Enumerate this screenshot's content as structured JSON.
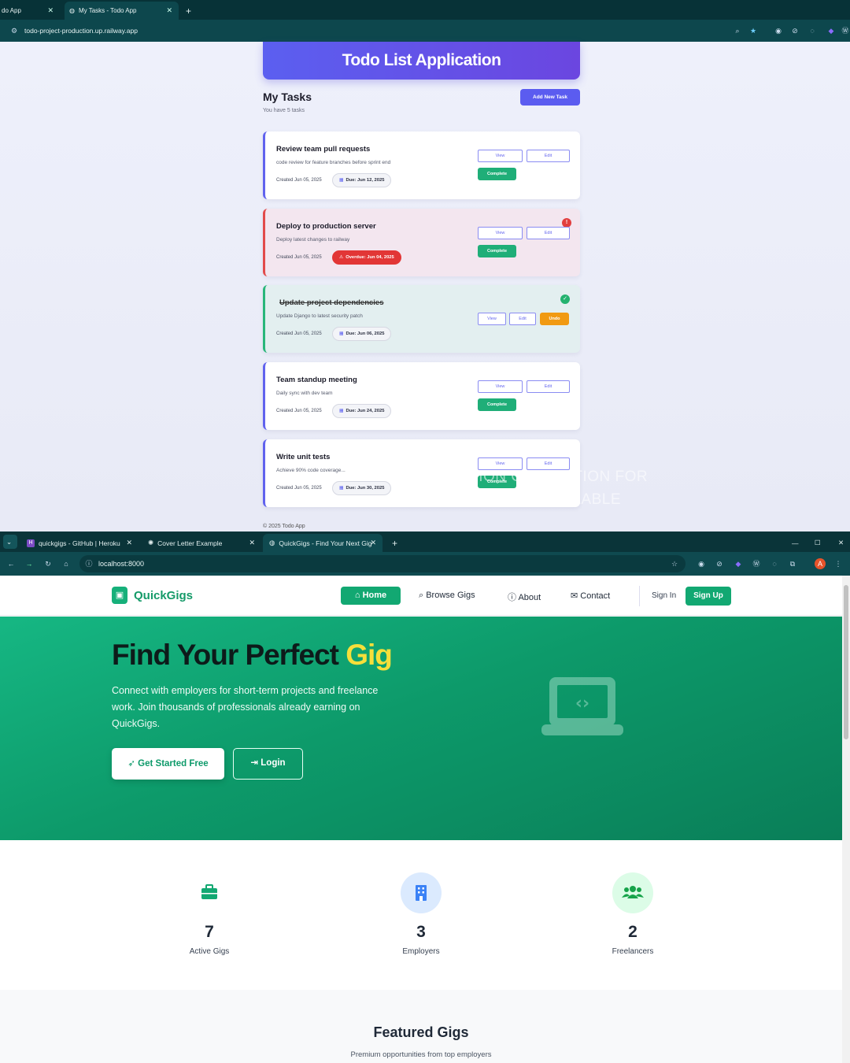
{
  "top_browser": {
    "tabs": [
      {
        "title": "do App"
      },
      {
        "title": "My Tasks - Todo App"
      }
    ],
    "url": "todo-project-production.up.railway.app",
    "header_title": "Todo List Application",
    "section_title": "My Tasks",
    "task_count": "You have 5 tasks",
    "add_button": "Add New Task",
    "tasks": [
      {
        "title": "Review team pull requests",
        "description": "code review for feature branches before sprint end",
        "created": "Created Jun 05, 2025",
        "due": "Due: Jun 12, 2025",
        "status": "pending",
        "view": "View",
        "edit": "Edit",
        "action": "Complete"
      },
      {
        "title": "Deploy to production server",
        "description": "Deploy latest changes to railway",
        "created": "Created Jun 05, 2025",
        "due": "Overdue: Jun 04, 2025",
        "status": "overdue",
        "badge": "!",
        "view": "View",
        "edit": "Edit",
        "action": "Complete"
      },
      {
        "title": "Update project dependencies",
        "description": "Update Django to latest security patch",
        "created": "Created Jun 05, 2025",
        "due": "Due: Jun 06, 2025",
        "status": "completed",
        "badge": "✓",
        "view": "View",
        "edit": "Edit",
        "action": "Undo"
      },
      {
        "title": "Team standup meeting",
        "description": "Daily sync with dev team",
        "created": "Created Jun 05, 2025",
        "due": "Due: Jun 24, 2025",
        "status": "pending",
        "view": "View",
        "edit": "Edit",
        "action": "Complete"
      },
      {
        "title": "Write unit tests",
        "description": "Achieve 90% code coverage...",
        "created": "Created Jun 05, 2025",
        "due": "Due: Jun 30, 2025",
        "status": "pending",
        "view": "View",
        "edit": "Edit",
        "action": "Complete"
      }
    ],
    "footer": "© 2025 Todo App",
    "overlay_line1": "NEW FASHION COLLECTION FOR",
    "overlay_line2": "THIS FALL IS NOW AVAILABLE"
  },
  "bottom_browser": {
    "tabs": [
      {
        "title": "quickgigs - GitHub | Heroku"
      },
      {
        "title": "Cover Letter Example"
      },
      {
        "title": "QuickGigs - Find Your Next Gig"
      }
    ],
    "url": "localhost:8000",
    "brand": "QuickGigs",
    "nav": {
      "home": "Home",
      "browse": "Browse Gigs",
      "about": "About",
      "contact": "Contact",
      "signin": "Sign In",
      "signup": "Sign Up"
    },
    "hero": {
      "title_main": "Find Your Perfect ",
      "title_accent": "Gig",
      "subtitle": "Connect with employers for short-term projects and freelance work. Join thousands of professionals already earning on QuickGigs.",
      "cta_primary": "Get Started Free",
      "cta_secondary": "Login"
    },
    "stats": [
      {
        "value": "7",
        "label": "Active Gigs",
        "icon": "briefcase-icon"
      },
      {
        "value": "3",
        "label": "Employers",
        "icon": "building-icon"
      },
      {
        "value": "2",
        "label": "Freelancers",
        "icon": "users-icon"
      }
    ],
    "featured": {
      "title": "Featured Gigs",
      "subtitle": "Premium opportunities from top employers"
    },
    "colors": {
      "brand": "#12a872",
      "accent": "#f6df3a"
    }
  }
}
